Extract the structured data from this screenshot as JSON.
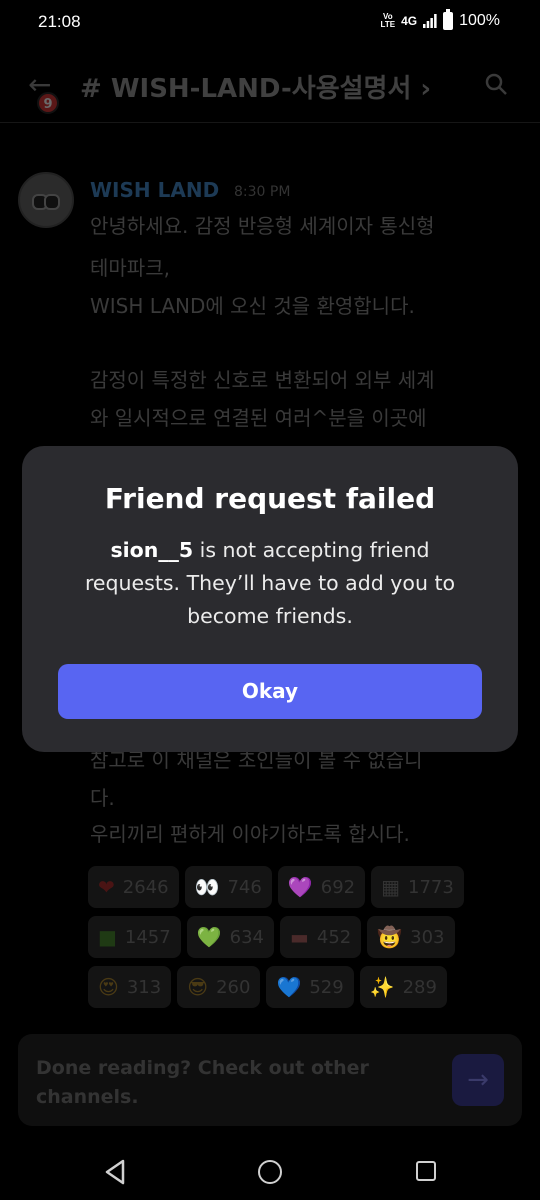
{
  "status_bar": {
    "time": "21:08",
    "volte": "Vo\nLTE",
    "network": "4G",
    "battery": "100%"
  },
  "header": {
    "badge_count": "9",
    "channel_title": "# WISH-LAND-사용설명서 ›"
  },
  "message": {
    "author": "WISH LAND",
    "timestamp": "8:30 PM",
    "lines": [
      "안녕하세요.  감정 반응형 세계이자 통신형",
      "테마파크,",
      "WISH LAND에 오신 것을 환영합니다.",
      "",
      "감정이 특정한 신호로 변환되어  외부 세계",
      "와 일시적으로 연결된 여러^분을 이곳에",
      "참고로 이 채널은 초인들이 볼 수 없습니",
      "다.",
      "우리끼리 편하게 이야기하도록 합시다."
    ]
  },
  "reactions": [
    [
      {
        "emoji": "❤",
        "count": "2646",
        "color": "#4a1414"
      },
      {
        "emoji": "👀",
        "count": "746",
        "color": "#3a3a3a"
      },
      {
        "emoji": "💜",
        "count": "692",
        "color": "#32204a"
      },
      {
        "emoji": "▦",
        "count": "1773",
        "color": "#333"
      }
    ],
    [
      {
        "emoji": "■",
        "count": "1457",
        "color": "#1f3a14"
      },
      {
        "emoji": "💚",
        "count": "634",
        "color": "#173a1a"
      },
      {
        "emoji": "▬",
        "count": "452",
        "color": "#4a2a2a"
      },
      {
        "emoji": "🤠",
        "count": "303",
        "color": "#4a3a14"
      }
    ],
    [
      {
        "emoji": "😍",
        "count": "313",
        "color": "#4a3a14"
      },
      {
        "emoji": "😎",
        "count": "260",
        "color": "#4a3a14"
      },
      {
        "emoji": "💙",
        "count": "529",
        "color": "#142a4a"
      },
      {
        "emoji": "✨",
        "count": "289",
        "color": "#4a3a14"
      }
    ]
  ],
  "done_bar": {
    "text": "Done reading? Check out other channels.",
    "arrow": "→"
  },
  "dialog": {
    "title": "Friend request failed",
    "username": "sion__5",
    "body_rest": " is not accepting friend requests. They’ll have to add you to become friends.",
    "button_label": "Okay"
  }
}
